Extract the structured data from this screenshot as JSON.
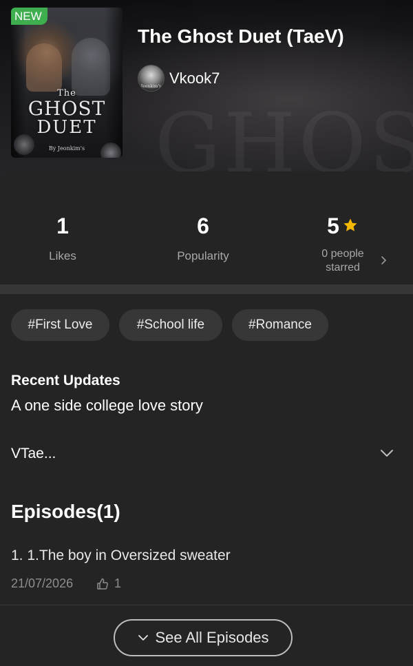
{
  "header": {
    "badge": "NEW",
    "title": "The Ghost Duet (TaeV)",
    "author": "Vkook7",
    "background_word": "GHOST",
    "cover": {
      "line1": "The",
      "line2": "GHOST",
      "line3": "DUET",
      "byline": "By Jeonkim's"
    },
    "avatar_text": "Jeonkim's"
  },
  "stats": {
    "likes": {
      "value": "1",
      "label": "Likes"
    },
    "popularity": {
      "value": "6",
      "label": "Popularity"
    },
    "rating": {
      "value": "5",
      "label_line1": "0 people",
      "label_line2": "starred",
      "star_color": "#f5b800"
    }
  },
  "tags": [
    "#First Love",
    "#School life",
    "#Romance"
  ],
  "recent": {
    "title": "Recent Updates",
    "text": "A one side college love story",
    "more": "VTae..."
  },
  "episodes": {
    "title": "Episodes(1)",
    "items": [
      {
        "title": "1. 1.The boy in Oversized sweater",
        "date": "21/07/2026",
        "likes": "1"
      }
    ],
    "see_all": "See All Episodes"
  },
  "colors": {
    "background": "#242424",
    "divider": "#363636",
    "tag_bg": "#373737",
    "badge": "#3fae4f",
    "star": "#f5b800"
  },
  "icons": [
    "star-icon",
    "chevron-right-icon",
    "chevron-down-icon",
    "thumbs-up-icon"
  ]
}
